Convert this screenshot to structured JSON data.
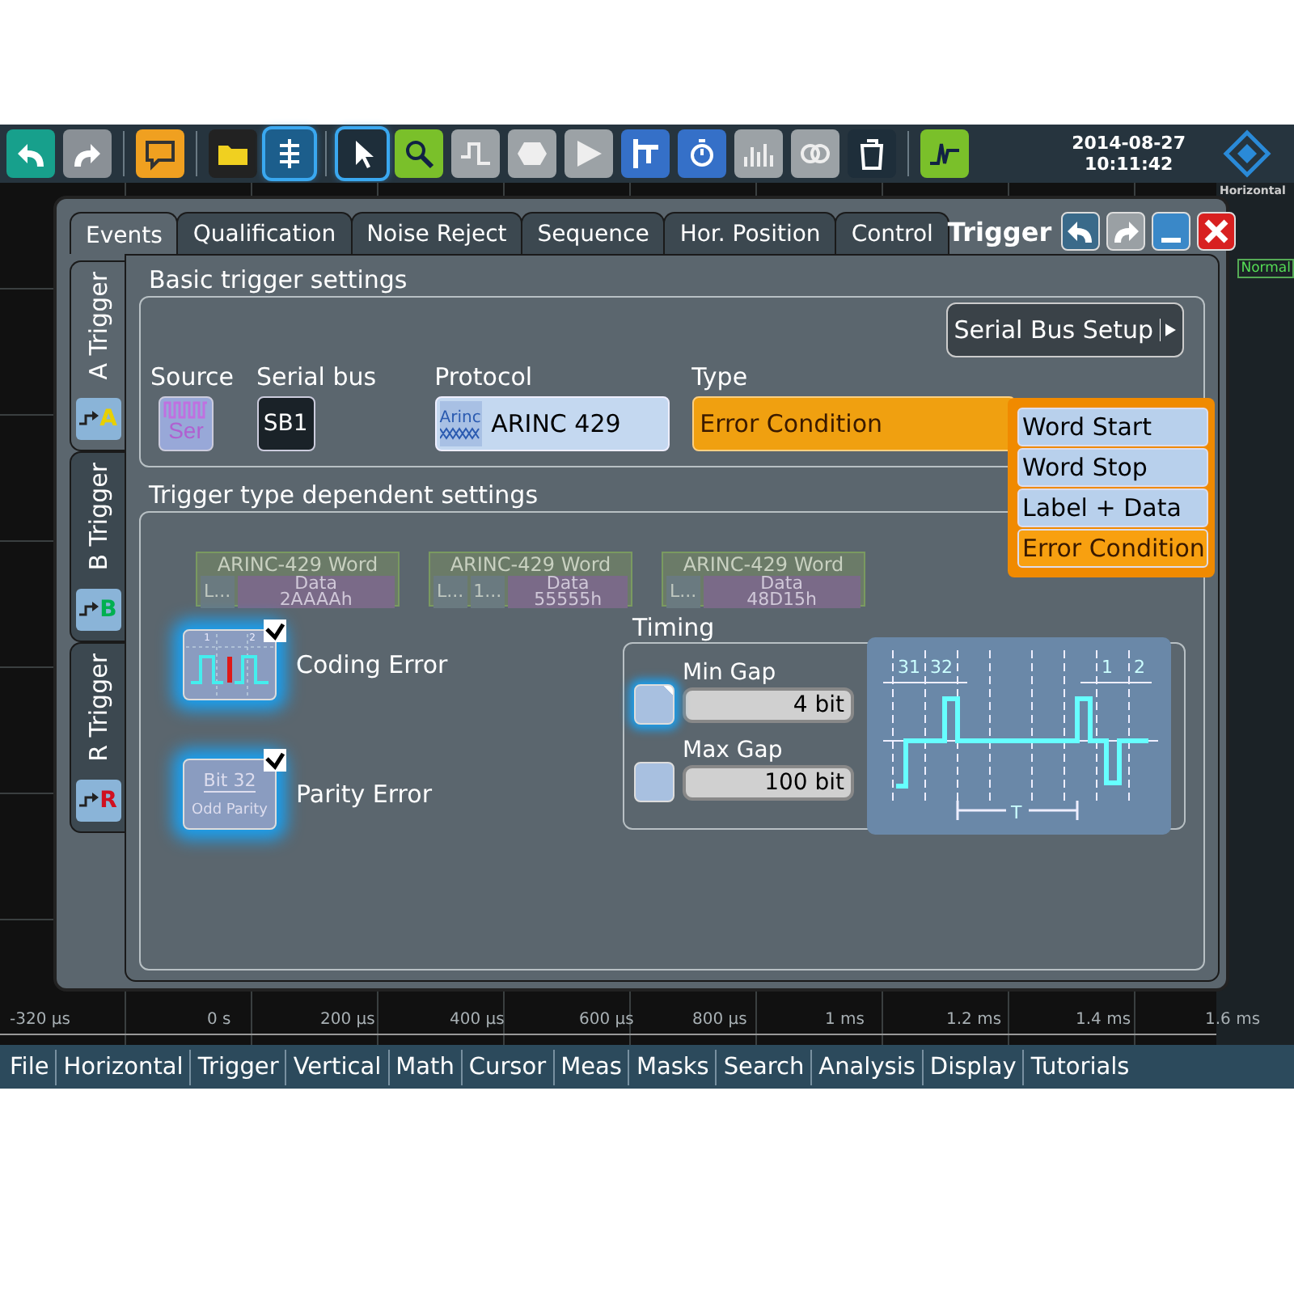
{
  "toolbar": {
    "date": "2014-08-27",
    "time": "10:11:42"
  },
  "side_panel": {
    "title": "Horizontal",
    "mode": "Normal"
  },
  "dialog": {
    "title": "Trigger",
    "tabs": [
      {
        "label": "Events",
        "selected": true
      },
      {
        "label": "Qualification",
        "selected": false
      },
      {
        "label": "Noise Reject",
        "selected": false
      },
      {
        "label": "Sequence",
        "selected": false
      },
      {
        "label": "Hor. Position",
        "selected": false
      },
      {
        "label": "Control",
        "selected": false
      }
    ],
    "side_tabs": [
      {
        "label": "A Trigger",
        "letter": "A",
        "color": "#e8d000",
        "selected": true
      },
      {
        "label": "B Trigger",
        "letter": "B",
        "color": "#00b050",
        "selected": false
      },
      {
        "label": "R Trigger",
        "letter": "R",
        "color": "#d01020",
        "selected": false
      }
    ],
    "basic": {
      "title": "Basic trigger settings",
      "setup_button": "Serial Bus Setup",
      "source": {
        "label": "Source",
        "value": "Ser"
      },
      "serial_bus": {
        "label": "Serial bus",
        "value": "SB1"
      },
      "protocol": {
        "label": "Protocol",
        "icon_text": "Arinc",
        "value": "ARINC 429"
      },
      "type": {
        "label": "Type",
        "value": "Error Condition",
        "expanded": true,
        "options": [
          {
            "label": "Word Start",
            "selected": false
          },
          {
            "label": "Word Stop",
            "selected": false
          },
          {
            "label": "Label + Data",
            "selected": false
          },
          {
            "label": "Error Condition",
            "selected": true
          }
        ]
      }
    },
    "dependent": {
      "title": "Trigger type dependent settings",
      "errors": [
        {
          "kind": "coding",
          "label": "Coding Error",
          "checked": true,
          "icon_texts": [
            "1",
            "2"
          ]
        },
        {
          "kind": "parity",
          "label": "Parity Error",
          "checked": true,
          "icon_texts": [
            "Bit 32",
            "Odd Parity"
          ]
        }
      ],
      "timing": {
        "title": "Timing",
        "gaps": [
          {
            "label": "Min Gap",
            "checked": true,
            "value": "4 bit"
          },
          {
            "label": "Max Gap",
            "checked": false,
            "value": "100 bit"
          }
        ],
        "diagram_labels": [
          "31",
          "32",
          "1",
          "2",
          "T"
        ]
      }
    }
  },
  "decode_words": [
    {
      "title": "ARINC-429 Word",
      "labels": [
        "L..."
      ],
      "data_label": "Data",
      "data": "2AAAAh"
    },
    {
      "title": "ARINC-429 Word",
      "labels": [
        "L...",
        "1..."
      ],
      "data_label": "Data",
      "data": "55555h"
    },
    {
      "title": "ARINC-429 Word",
      "labels": [
        "L..."
      ],
      "data_label": "Data",
      "data": "48D15h"
    }
  ],
  "time_axis": [
    "-320 µs",
    "0 s",
    "200 µs",
    "400 µs",
    "600 µs",
    "800 µs",
    "1 ms",
    "1.2 ms",
    "1.4 ms",
    "1.6 ms"
  ],
  "menu": [
    "File",
    "Horizontal",
    "Trigger",
    "Vertical",
    "Math",
    "Cursor",
    "Meas",
    "Masks",
    "Search",
    "Analysis",
    "Display",
    "Tutorials"
  ]
}
